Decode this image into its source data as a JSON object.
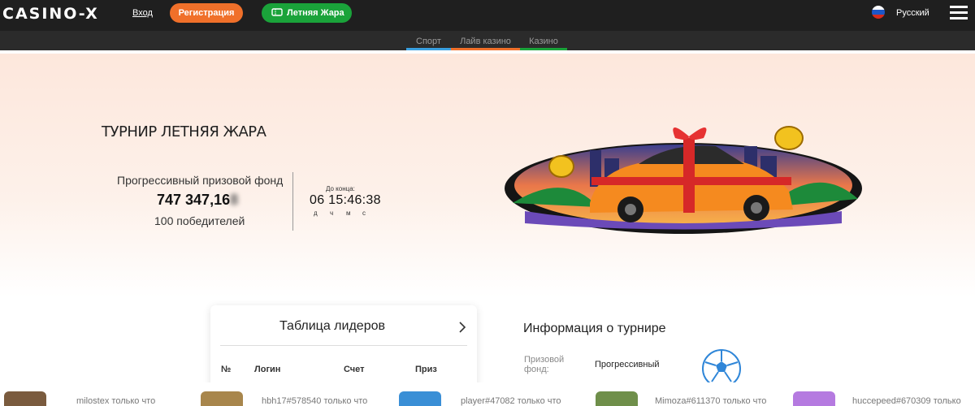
{
  "header": {
    "logo": "CASINO-X",
    "login_label": "Вход",
    "register_label": "Регистрация",
    "promo_label": "Летняя Жара",
    "language": "Русский",
    "icons": [
      "russian-flag-icon",
      "hamburger-menu-icon",
      "ticket-icon"
    ]
  },
  "subnav": {
    "tabs": [
      {
        "label": "Спорт",
        "color": "#3aa0e0"
      },
      {
        "label": "Лайв казино",
        "color": "#f0702a"
      },
      {
        "label": "Казино",
        "color": "#1aa33a"
      }
    ]
  },
  "hero": {
    "title": "ТУРНИР ЛЕТНЯЯ ЖАРА",
    "fund_label": "Прогрессивный призовой фонд",
    "fund_amount": "747 347,16",
    "fund_amount_hidden": "8",
    "winners": "100 победителей",
    "to_end_label": "До конца:",
    "countdown": "06 15:46:38",
    "units": [
      "д",
      "ч",
      "м",
      "с"
    ]
  },
  "leaderboard": {
    "title": "Таблица лидеров",
    "columns": [
      "№",
      "Логин",
      "Счет",
      "Приз"
    ]
  },
  "info": {
    "title": "Информация о турнире",
    "prize_label_line1": "Призовой",
    "prize_label_line2": "фонд:",
    "prize_value": "Прогрессивный"
  },
  "ticker": {
    "items": [
      {
        "text": "milostex только что"
      },
      {
        "text": "hbh17#578540 только что"
      },
      {
        "text": "player#47082 только что"
      },
      {
        "text": "Mimoza#611370 только что"
      },
      {
        "text": "huccepeed#670309 только"
      }
    ]
  },
  "colors": {
    "header_bg": "#1f1f1f",
    "register": "#f0702a",
    "promo": "#1aa33a",
    "hero_bg": "#fde7dc"
  }
}
